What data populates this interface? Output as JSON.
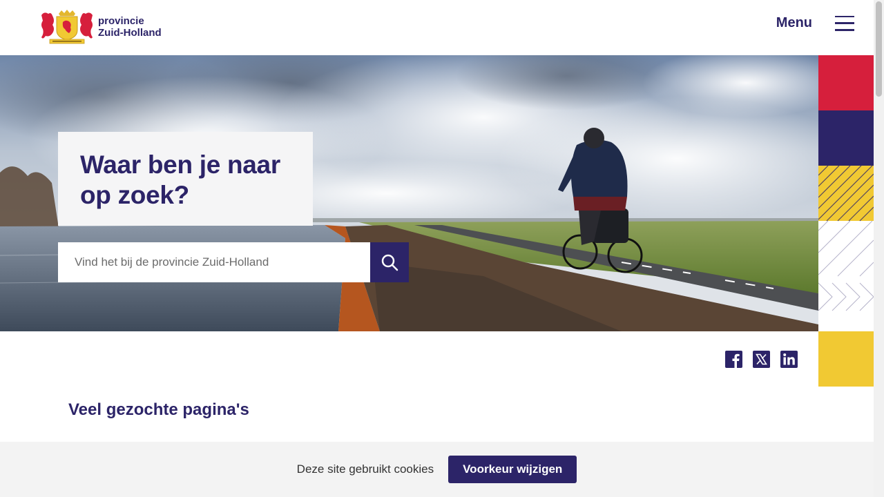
{
  "header": {
    "logo_line1": "provincie",
    "logo_line2": "Zuid-Holland",
    "menu_label": "Menu"
  },
  "hero": {
    "search_title": "Waar ben je naar op zoek?",
    "search_placeholder": "Vind het bij de provincie Zuid-Holland",
    "search_value": ""
  },
  "social": {
    "items": [
      "facebook-icon",
      "x-icon",
      "linkedin-icon"
    ]
  },
  "main": {
    "section_title": "Veel gezochte pagina's"
  },
  "cookie": {
    "text": "Deze site gebruikt cookies",
    "button_label": "Voorkeur wijzigen"
  },
  "colors": {
    "brand_navy": "#2c2468",
    "brand_red": "#d61f3c",
    "brand_yellow": "#f1c933"
  }
}
